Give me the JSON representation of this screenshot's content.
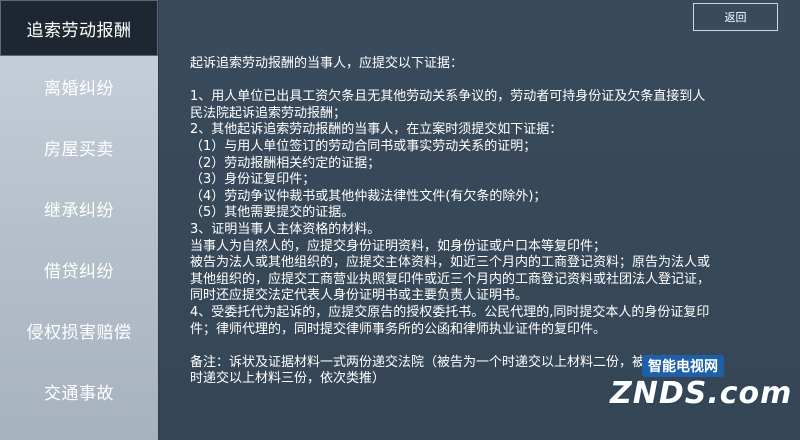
{
  "sidebar": {
    "items": [
      {
        "label": "追索劳动报酬"
      },
      {
        "label": "离婚纠纷"
      },
      {
        "label": "房屋买卖"
      },
      {
        "label": "继承纠纷"
      },
      {
        "label": "借贷纠纷"
      },
      {
        "label": "侵权损害赔偿"
      },
      {
        "label": "交通事故"
      }
    ]
  },
  "header": {
    "back_label": "返回"
  },
  "content": {
    "lines": [
      "起诉追索劳动报酬的当事人，应提交以下证据：",
      "",
      "1、用人单位已出具工资欠条且无其他劳动关系争议的，劳动者可持身份证及欠条直接到人",
      "民法院起诉追索劳动报酬；",
      "2、其他起诉追索劳动报酬的当事人，在立案时须提交如下证据：",
      "（1）与用人单位签订的劳动合同书或事实劳动关系的证明；",
      "（2）劳动报酬相关约定的证据；",
      "（3）身份证复印件；",
      "（4）劳动争议仲裁书或其他仲裁法律性文件(有欠条的除外)；",
      "（5）其他需要提交的证据。",
      "3、证明当事人主体资格的材料。",
      "当事人为自然人的，应提交身份证明资料，如身份证或户口本等复印件；",
      "被告为法人或其他组织的，应提交主体资料，如近三个月内的工商登记资料；原告为法人或",
      "其他组织的，应提交工商营业执照复印件或近三个月内的工商登记资料或社团法人登记证，",
      "同时还应提交法定代表人身份证明书或主要负责人证明书。",
      "4、受委托代为起诉的，应提交原告的授权委托书。公民代理的,同时提交本人的身份证复印",
      "件；律师代理的，同时提交律师事务所的公函和律师执业证件的复印件。",
      "",
      "备注：诉状及证据材料一式两份递交法院（被告为一个时递交以上材料二份，被告为两个",
      "时递交以上材料三份，依次类推）"
    ]
  },
  "watermark": {
    "cn": "智能电视网",
    "logo": "ZNDS.com"
  }
}
